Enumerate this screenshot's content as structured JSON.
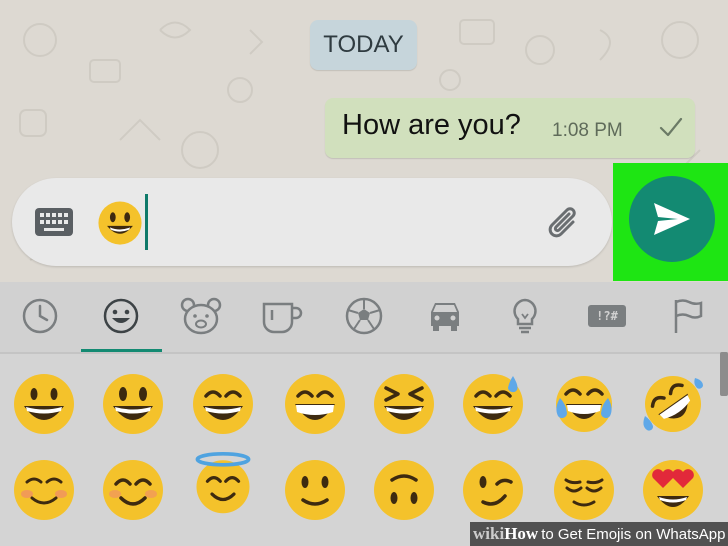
{
  "chat": {
    "date_label": "TODAY",
    "message": {
      "text": "How are you?",
      "time": "1:08 PM",
      "status_icon": "single-check-icon"
    }
  },
  "composer": {
    "keyboard_icon": "keyboard-icon",
    "typed_content": "slightly-smiling-face-emoji",
    "attach_icon": "paperclip-icon",
    "send_icon": "send-arrow-icon"
  },
  "emoji_keyboard": {
    "category_tabs": [
      {
        "icon": "clock-icon",
        "name": "recent"
      },
      {
        "icon": "smiley-icon",
        "name": "smileys",
        "selected": true
      },
      {
        "icon": "bear-icon",
        "name": "animals"
      },
      {
        "icon": "cup-icon",
        "name": "food"
      },
      {
        "icon": "soccer-ball-icon",
        "name": "activity"
      },
      {
        "icon": "car-icon",
        "name": "travel"
      },
      {
        "icon": "lightbulb-icon",
        "name": "objects"
      },
      {
        "icon": "symbols-icon",
        "name": "symbols",
        "label": "!?#"
      },
      {
        "icon": "flag-icon",
        "name": "flags"
      }
    ],
    "emoji_rows": [
      [
        "grinning-face",
        "smiling-face-open-mouth",
        "smiling-face-smiling-eyes",
        "grinning-face-smiling-eyes",
        "squinting-face",
        "grinning-face-sweat",
        "tears-of-joy",
        "rolling-on-floor-laughing"
      ],
      [
        "smiling-face-blush",
        "smiling-face",
        "smiling-face-halo",
        "slightly-smiling-face",
        "upside-down-face",
        "winking-face",
        "relieved-face",
        "heart-eyes-face"
      ]
    ]
  },
  "colors": {
    "accent": "#138a72",
    "highlight": "#1ee513",
    "outgoing_bubble": "#d1e0bd",
    "date_pill": "#c6d5db",
    "emoji_yellow": "#f4c22b"
  },
  "watermark": {
    "logo": "wiki",
    "how": "How",
    "title": "to Get Emojis on WhatsApp"
  }
}
